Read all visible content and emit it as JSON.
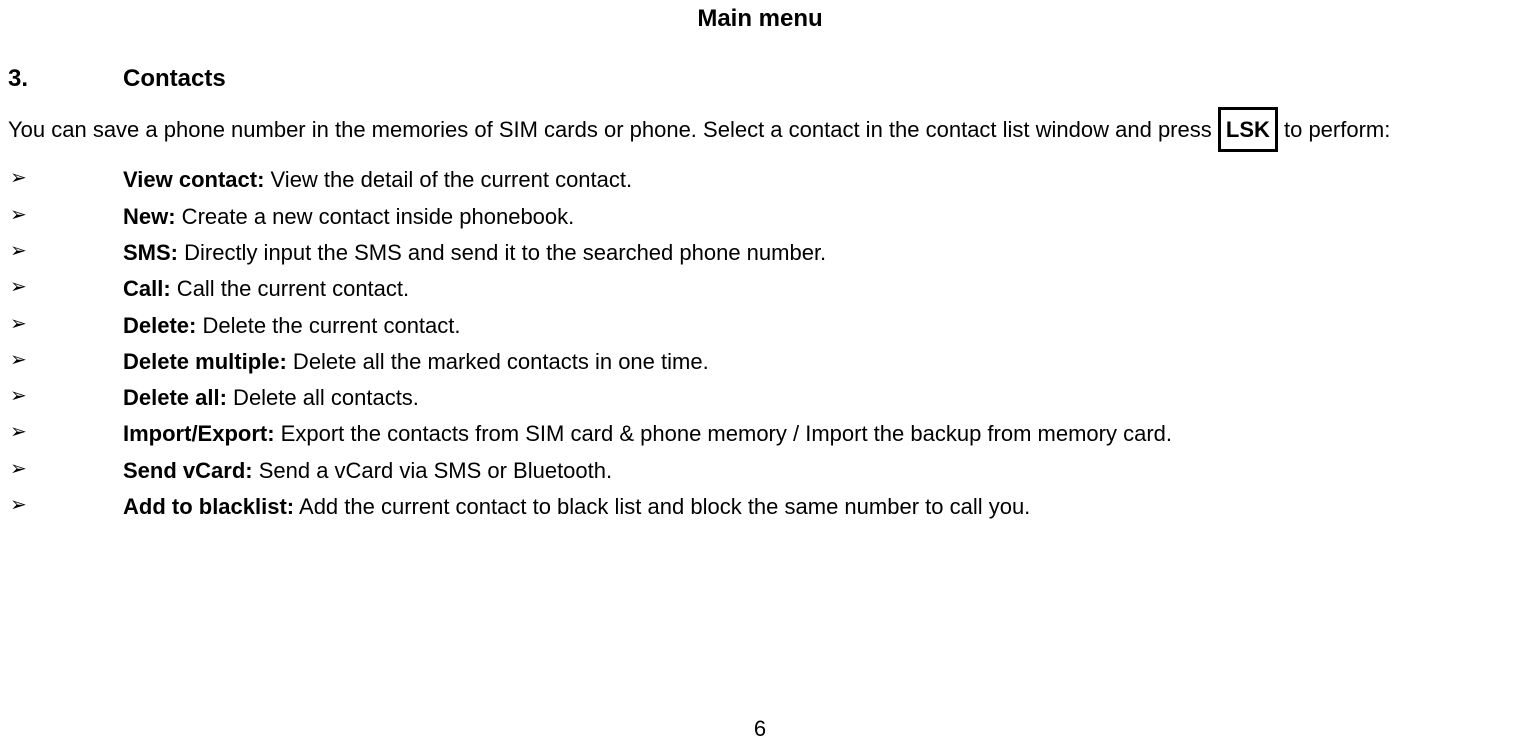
{
  "title": "Main menu",
  "section": {
    "number": "3.",
    "heading": "Contacts",
    "intro_before_lsk": "You can save a phone number in the memories of SIM cards or phone. Select a contact in the contact list window and press ",
    "lsk_label": "LSK",
    "intro_after_lsk": " to perform:"
  },
  "bullet_glyph": "➢",
  "items": [
    {
      "label": "View contact:",
      "desc": " View the detail of the current contact."
    },
    {
      "label": "New:",
      "desc": " Create a new contact inside phonebook."
    },
    {
      "label": "SMS:",
      "desc": " Directly input the SMS and send it to the searched phone number."
    },
    {
      "label": "Call:",
      "desc": " Call the current contact."
    },
    {
      "label": "Delete:",
      "desc": " Delete the current contact."
    },
    {
      "label": "Delete multiple:",
      "desc": " Delete all the marked contacts in one time."
    },
    {
      "label": "Delete all:",
      "desc": " Delete all contacts."
    },
    {
      "label": "Import/Export:",
      "desc": " Export the contacts from SIM card & phone memory / Import the backup from memory card."
    },
    {
      "label": "Send vCard:",
      "desc": " Send a vCard via SMS or Bluetooth."
    },
    {
      "label": "Add to blacklist:",
      "desc": " Add the current contact to black list and block the same number to call you."
    }
  ],
  "page_number": "6"
}
